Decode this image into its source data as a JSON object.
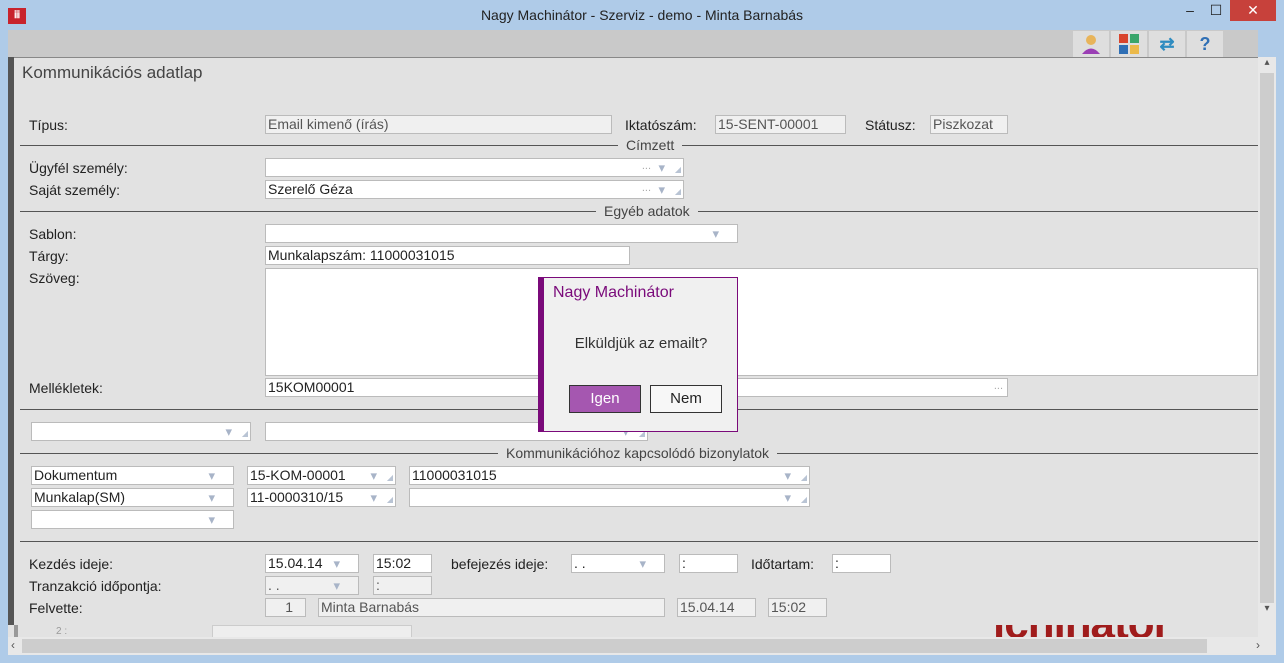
{
  "window": {
    "title": "Nagy Machinátor - Szerviz - demo - Minta Barnabás",
    "logo_text": "ꟷꟷ",
    "minimize": "–",
    "maximize": "☐",
    "close": "✕"
  },
  "toolbar": {
    "user": "user-icon",
    "apps": "apps-icon",
    "sync": "sync-icon",
    "help": "?"
  },
  "form": {
    "title": "Kommunikációs adatlap",
    "tipus_label": "Típus:",
    "tipus_value": "Email kimenő (írás)",
    "iktato_label": "Iktatószám:",
    "iktato_value": "15-SENT-00001",
    "status_label": "Státusz:",
    "status_value": "Piszkozat",
    "cimzett_legend": "Címzett",
    "ugyfel_label": "Ügyfél személy:",
    "ugyfel_value": "",
    "sajat_label": "Saját személy:",
    "sajat_value": "Szerelő Géza",
    "egyeb_legend": "Egyéb adatok",
    "sablon_label": "Sablon:",
    "sablon_value": "",
    "targy_label": "Tárgy:",
    "targy_value": "Munkalapszám: 11000031015",
    "szoveg_label": "Szöveg:",
    "szoveg_value": "",
    "mellek_label": "Mellékletek:",
    "mellek_value": "15KOM00001",
    "ellipsis": "...",
    "kapcs_legend": "Kommunikációhoz kapcsolódó bizonylatok",
    "docs": [
      {
        "type": "Dokumentum",
        "id": "15-KOM-00001",
        "ref": "11000031015"
      },
      {
        "type": "Munkalap(SM)",
        "id": "11-0000310/15",
        "ref": ""
      },
      {
        "type": "",
        "id": null,
        "ref": null
      }
    ],
    "kezdes_label": "Kezdés ideje:",
    "kezdes_date": "15.04.14",
    "kezdes_time": "15:02",
    "befejezes_label": "befejezés ideje:",
    "befejezes_date": ". .",
    "befejezes_time": ":",
    "idotartam_label": "Időtartam:",
    "idotartam_value": ":",
    "tranz_label": "Tranzakció időpontja:",
    "tranz_date": ". .",
    "tranz_time": ":",
    "felvette_label": "Felvette:",
    "felvette_id": "1",
    "felvette_name": "Minta Barnabás",
    "felvette_date": "15.04.14",
    "felvette_time": "15:02",
    "bg_label": "2 :",
    "bg_logo": "ichinátor"
  },
  "dialog": {
    "title": "Nagy Machinátor",
    "message": "Elküldjük az emailt?",
    "yes": "Igen",
    "no": "Nem"
  }
}
